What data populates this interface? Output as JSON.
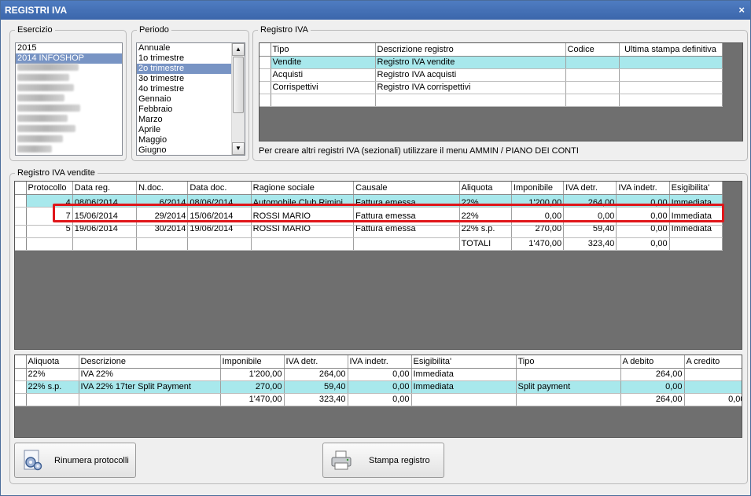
{
  "window": {
    "title": "REGISTRI IVA",
    "close_glyph": "×"
  },
  "esercizio": {
    "legend": "Esercizio",
    "items": [
      {
        "label": "2015",
        "selected": false
      },
      {
        "label": "2014 INFOSHOP",
        "selected": true
      }
    ],
    "blurred_count": 9
  },
  "periodo": {
    "legend": "Periodo",
    "items": [
      {
        "label": "Annuale",
        "selected": false
      },
      {
        "label": "1o trimestre",
        "selected": false
      },
      {
        "label": "2o trimestre",
        "selected": true
      },
      {
        "label": "3o trimestre",
        "selected": false
      },
      {
        "label": "4o trimestre",
        "selected": false
      },
      {
        "label": "Gennaio",
        "selected": false
      },
      {
        "label": "Febbraio",
        "selected": false
      },
      {
        "label": "Marzo",
        "selected": false
      },
      {
        "label": "Aprile",
        "selected": false
      },
      {
        "label": "Maggio",
        "selected": false
      },
      {
        "label": "Giugno",
        "selected": false
      }
    ]
  },
  "registro": {
    "legend": "Registro IVA",
    "columns": [
      "Tipo",
      "Descrizione registro",
      "Codice",
      "Ultima stampa definitiva"
    ],
    "rows": [
      {
        "tipo": "Vendite",
        "descrizione": "Registro IVA vendite",
        "codice": "",
        "ultima": "",
        "highlight": true
      },
      {
        "tipo": "Acquisti",
        "descrizione": "Registro IVA acquisti",
        "codice": "",
        "ultima": "",
        "highlight": false
      },
      {
        "tipo": "Corrispettivi",
        "descrizione": "Registro IVA corrispettivi",
        "codice": "",
        "ultima": "",
        "highlight": false
      }
    ],
    "hint": "Per creare altri registri IVA (sezionali) utilizzare il menu AMMIN / PIANO DEI CONTI"
  },
  "vendite": {
    "legend": "Registro IVA vendite",
    "columns": [
      "Protocollo",
      "Data reg.",
      "N.doc.",
      "Data doc.",
      "Ragione sociale",
      "Causale",
      "Aliquota",
      "Imponibile",
      "IVA detr.",
      "IVA indetr.",
      "Esigibilita'"
    ],
    "row_partial_top": [
      "4",
      "08/06/2014",
      "6/2014",
      "08/06/2014",
      "Automobile Club Rimini",
      "Fattura emessa",
      "22%",
      "1'200,00",
      "264,00",
      "0,00",
      "Immediata"
    ],
    "row_inserted": [
      "7",
      "15/06/2014",
      "29/2014",
      "15/06/2014",
      "ROSSI MARIO",
      "Fattura emessa",
      "22%",
      "0,00",
      "0,00",
      "0,00",
      "Immediata"
    ],
    "row_partial_bottom": [
      "5",
      "19/06/2014",
      "30/2014",
      "19/06/2014",
      "ROSSI MARIO",
      "Fattura emessa",
      "22% s.p.",
      "270,00",
      "59,40",
      "0,00",
      "Immediata"
    ],
    "totals": {
      "label": "TOTALI",
      "imponibile": "1'470,00",
      "iva_detr": "323,40",
      "iva_indetr": "0,00"
    }
  },
  "riepilogo": {
    "columns": [
      "Aliquota",
      "Descrizione",
      "Imponibile",
      "IVA detr.",
      "IVA indetr.",
      "Esigibilita'",
      "Tipo",
      "A debito",
      "A credito"
    ],
    "rows": [
      {
        "cells": [
          "22%",
          "IVA 22%",
          "1'200,00",
          "264,00",
          "0,00",
          "Immediata",
          "",
          "264,00",
          ""
        ],
        "highlight": false
      },
      {
        "cells": [
          "22% s.p.",
          "IVA 22% 17ter Split Payment",
          "270,00",
          "59,40",
          "0,00",
          "Immediata",
          "Split payment",
          "0,00",
          ""
        ],
        "highlight": true
      },
      {
        "cells": [
          "",
          "",
          "1'470,00",
          "323,40",
          "0,00",
          "",
          "",
          "264,00",
          "0,00"
        ],
        "highlight": false
      }
    ]
  },
  "buttons": {
    "rinumera": "Rinumera protocolli",
    "stampa": "Stampa registro"
  },
  "colors": {
    "title_bar": "#3b66ab",
    "selection": "#7894c4",
    "row_highlight": "#a8e8ec",
    "callout": "#e0161a",
    "grid_bg": "#6f6f6f"
  }
}
